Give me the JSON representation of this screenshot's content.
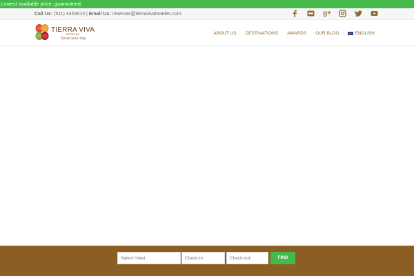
{
  "promo": {
    "text": "Lowest available price, guaranteed"
  },
  "contact": {
    "call_label": "Call Us:",
    "phone": "(511) 4453613",
    "separator": "|",
    "email_label": "Email Us:",
    "email": "reservas@tierravivahoteles.com"
  },
  "social": {
    "icons": [
      "facebook-icon",
      "flickr-icon",
      "google-plus-icon",
      "instagram-icon",
      "twitter-icon",
      "youtube-icon"
    ],
    "google_plus_glyph": "g+",
    "color": "#8d6a35"
  },
  "logo": {
    "title": "TIERRA VIVA",
    "subtitle": "HOTELES",
    "tagline": "Seize your day"
  },
  "nav": {
    "items": [
      {
        "label": "ABOUT US"
      },
      {
        "label": "DESTINATIONS"
      },
      {
        "label": "AWARDS"
      },
      {
        "label": "OUR BLOG"
      }
    ],
    "language": "ENGLISH"
  },
  "booking": {
    "hotel_placeholder": "Select Hotel",
    "checkin_placeholder": "Check-In",
    "checkout_placeholder": "Check-out",
    "find_label": "FIND"
  },
  "colors": {
    "brand_green": "#45b94a",
    "brand_brown": "#8b5e23",
    "nav_text": "#8d6a35"
  }
}
